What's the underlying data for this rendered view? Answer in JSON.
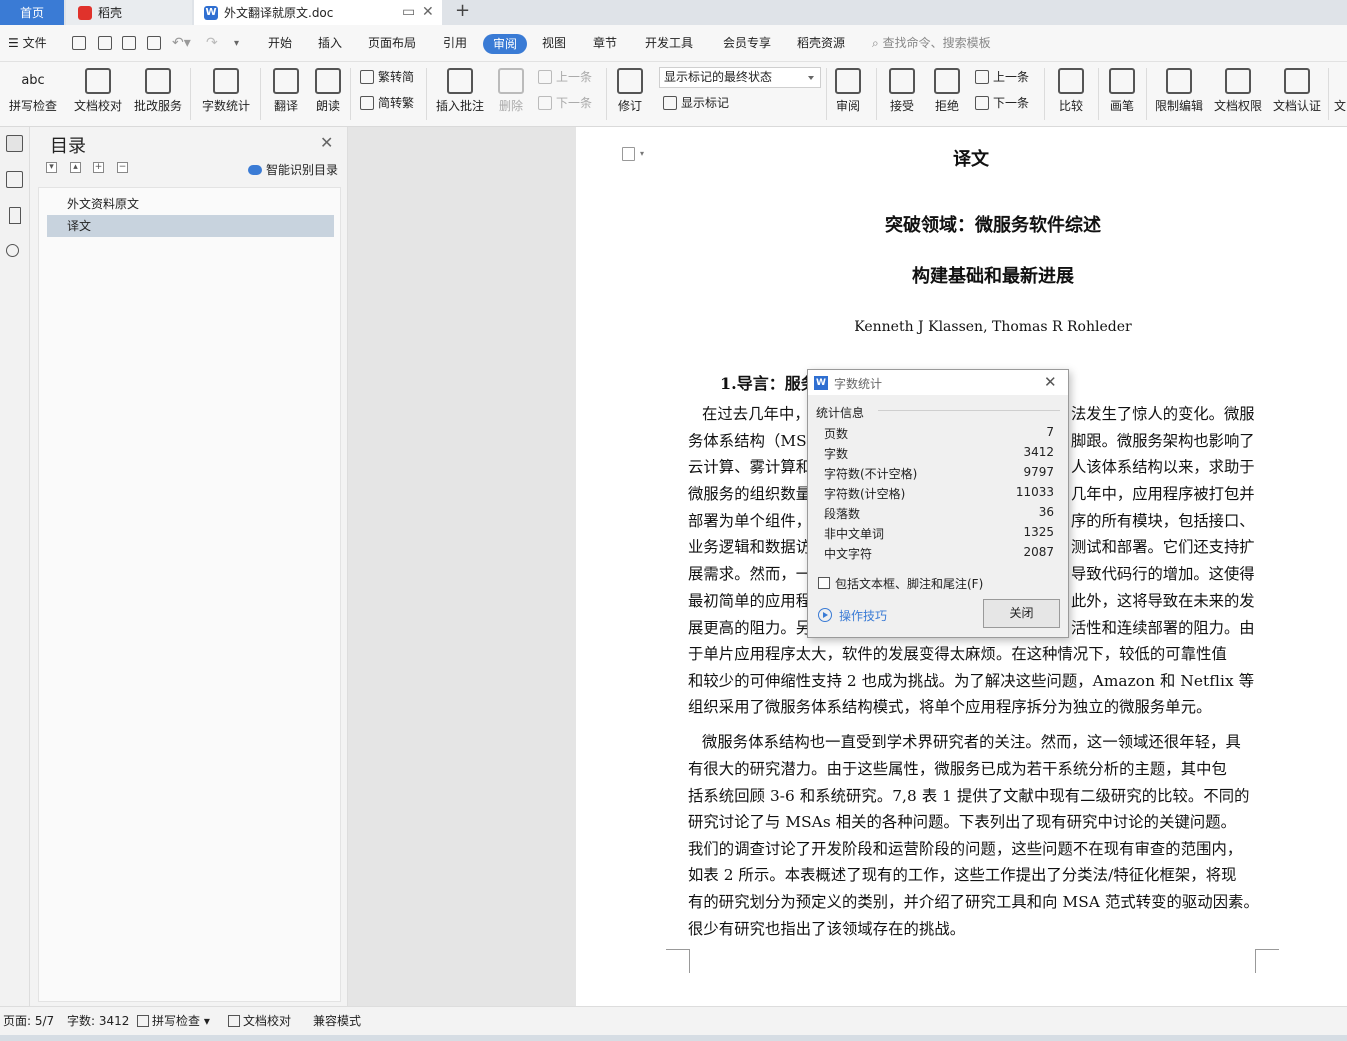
{
  "tabs": {
    "home": "首页",
    "daoke": "稻壳",
    "doc": "外文翻译就原文.doc"
  },
  "menu": {
    "file": "文件",
    "items": [
      "开始",
      "插入",
      "页面布局",
      "引用",
      "审阅",
      "视图",
      "章节",
      "开发工具",
      "会员专享",
      "稻壳资源"
    ],
    "active": "审阅",
    "search_placeholder": "查找命令、搜索模板"
  },
  "ribbon": {
    "spell_check": "拼写检查",
    "doc_proof": "文档校对",
    "correction_service": "批改服务",
    "word_count": "字数统计",
    "translate": "翻译",
    "read_aloud": "朗读",
    "trad_to_simp": "繁转简",
    "simp_to_trad": "简转繁",
    "insert_comment": "插入批注",
    "delete": "删除",
    "prev_comment": "上一条",
    "next_comment": "下一条",
    "track_changes": "修订",
    "markup_mode": "显示标记的最终状态",
    "show_markup": "显示标记",
    "review": "审阅",
    "accept": "接受",
    "reject": "拒绝",
    "prev_change": "上一条",
    "next_change": "下一条",
    "compare": "比较",
    "ink": "画笔",
    "restrict_edit": "限制编辑",
    "doc_permission": "文档权限",
    "doc_cert": "文档认证",
    "more": "文"
  },
  "nav": {
    "title": "目录",
    "smart_toc": "智能识别目录",
    "items": [
      "外文资料原文",
      "译文"
    ],
    "selected": "译文"
  },
  "document": {
    "title": "译文",
    "heading1": "突破领域：微服务软件综述",
    "heading2": "构建基础和最新进展",
    "authors": "Kenneth J Klassen, Thomas R Rohleder",
    "section": "1.导言：服务",
    "lines": [
      "在过去几年中，",
      "务体系结构（MS",
      "云计算、雾计算和",
      "微服务的组织数量",
      "部署为单个组件，",
      "业务逻辑和数据访",
      "展需求。然而，一",
      "最初简单的应用程",
      "展更高的阻力。另",
      "于单片应用程序太大，软件的发展变得太麻烦。在这种情况下，较低的可靠性值",
      "和较少的可伸缩性支持 2 也成为挑战。为了解决这些问题，Amazon 和 Netflix 等",
      "组织采用了微服务体系结构模式，将单个应用程序拆分为独立的微服务单元。",
      "微服务体系结构也一直受到学术界研究者的关注。然而，这一领域还很年轻，具",
      "有很大的研究潜力。由于这些属性，微服务已成为若干系统分析的主题，其中包",
      "括系统回顾 3-6 和系统研究。7,8 表 1 提供了文献中现有二级研究的比较。不同的",
      "研究讨论了与 MSAs 相关的各种问题。下表列出了现有研究中讨论的关键问题。",
      "我们的调查讨论了开发阶段和运营阶段的问题，这些问题不在现有审查的范围内，",
      "如表 2 所示。本表概述了现有的工作，这些工作提出了分类法/特征化框架，将现",
      "有的研究划分为预定义的类别，并介绍了研究工具和向 MSA 范式转变的驱动因素。",
      "很少有研究也指出了该领域存在的挑战。"
    ],
    "right_fragments": [
      "法发生了惊人的变化。微服",
      "脚跟。微服务架构也影响了",
      "人该体系结构以来，求助于",
      "几年中，应用程序被打包并",
      "序的所有模块，包括接口、",
      "测试和部署。它们还支持扩",
      "导致代码行的增加。这使得",
      "此外，这将导致在未来的发",
      "活性和连续部署的阻力。由"
    ]
  },
  "dialog": {
    "title": "字数统计",
    "group_label": "统计信息",
    "stats": [
      {
        "label": "页数",
        "value": "7"
      },
      {
        "label": "字数",
        "value": "3412"
      },
      {
        "label": "字符数(不计空格)",
        "value": "9797"
      },
      {
        "label": "字符数(计空格)",
        "value": "11033"
      },
      {
        "label": "段落数",
        "value": "36"
      },
      {
        "label": "非中文单词",
        "value": "1325"
      },
      {
        "label": "中文字符",
        "value": "2087"
      }
    ],
    "checkbox_label": "包括文本框、脚注和尾注(F)",
    "checkbox_checked": false,
    "tips": "操作技巧",
    "close_button": "关闭"
  },
  "status": {
    "page": "页面: 5/7",
    "word_count": "字数: 3412",
    "spell_check": "拼写检查",
    "doc_proof": "文档校对",
    "compat_mode": "兼容模式"
  },
  "colors": {
    "accent": "#3a7bd5",
    "selection": "#c8d3de",
    "link": "#3a7bd5"
  }
}
